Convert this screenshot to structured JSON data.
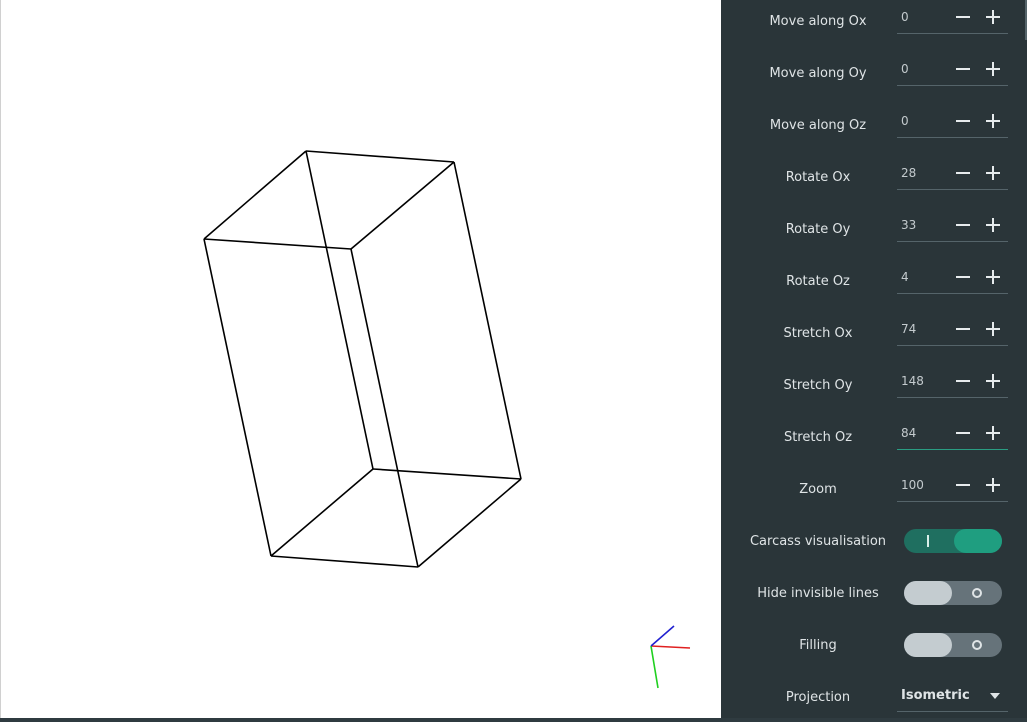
{
  "controls": {
    "move_ox": {
      "label": "Move along Ox",
      "value": "0"
    },
    "move_oy": {
      "label": "Move along Oy",
      "value": "0"
    },
    "move_oz": {
      "label": "Move along Oz",
      "value": "0"
    },
    "rotate_ox": {
      "label": "Rotate Ox",
      "value": "28"
    },
    "rotate_oy": {
      "label": "Rotate Oy",
      "value": "33"
    },
    "rotate_oz": {
      "label": "Rotate Oz",
      "value": "4"
    },
    "stretch_ox": {
      "label": "Stretch Ox",
      "value": "74"
    },
    "stretch_oy": {
      "label": "Stretch Oy",
      "value": "148"
    },
    "stretch_oz": {
      "label": "Stretch Oz",
      "value": "84"
    },
    "zoom": {
      "label": "Zoom",
      "value": "100"
    }
  },
  "toggles": {
    "carcass": {
      "label": "Carcass visualisation",
      "state": "on"
    },
    "hide_lines": {
      "label": "Hide invisible lines",
      "state": "off"
    },
    "filling": {
      "label": "Filling",
      "state": "off"
    }
  },
  "projection": {
    "label": "Projection",
    "value": "Isometric"
  },
  "axis_colors": {
    "x": "#e02020",
    "y": "#20d020",
    "z": "#2020d0"
  },
  "colors": {
    "panel_bg": "#2a3539",
    "accent": "#1f9e80",
    "wireframe": "#000000"
  }
}
